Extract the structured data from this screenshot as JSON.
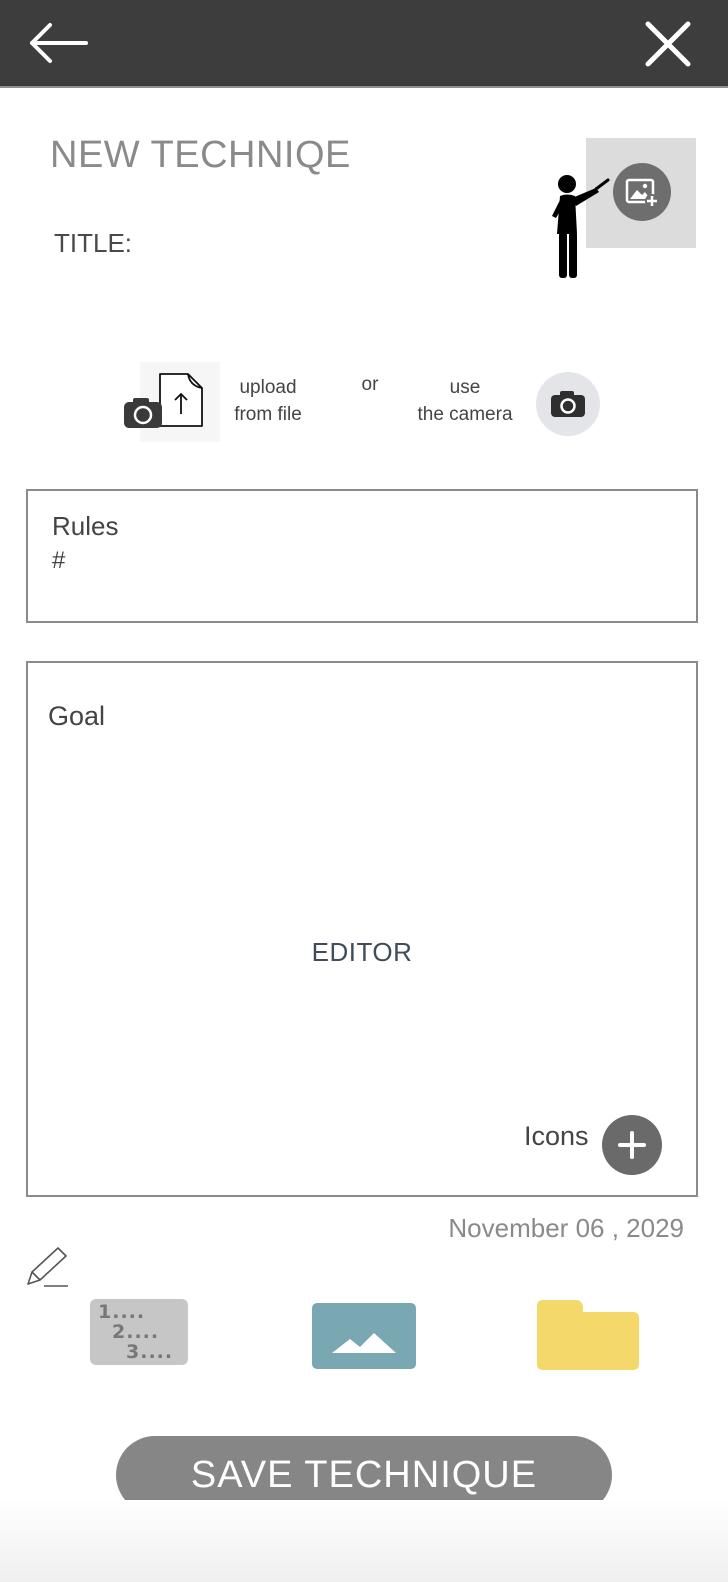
{
  "header": {
    "back_icon": "arrow-left-icon",
    "close_icon": "close-icon"
  },
  "form": {
    "heading": "NEW TECHNIQE",
    "title_label": "TITLE:",
    "title_value": ""
  },
  "media": {
    "upload_label_line1": "upload",
    "upload_label_line2": "from file",
    "or_label": "or",
    "camera_label_line1": "use",
    "camera_label_line2": "the camera"
  },
  "rules": {
    "label": "Rules",
    "value": "#"
  },
  "goal": {
    "label": "Goal",
    "editor_placeholder": "EDITOR",
    "icons_label": "Icons"
  },
  "date": "November 06 , 2029",
  "toolbar": {
    "numbered_list": [
      "1....",
      "2....",
      "3...."
    ]
  },
  "save_button": "SAVE TECHNIQUE",
  "colors": {
    "header_bg": "#3d3d3d",
    "image_button": "#79a7b2",
    "folder_button": "#f4d869",
    "save_button": "#868686"
  }
}
